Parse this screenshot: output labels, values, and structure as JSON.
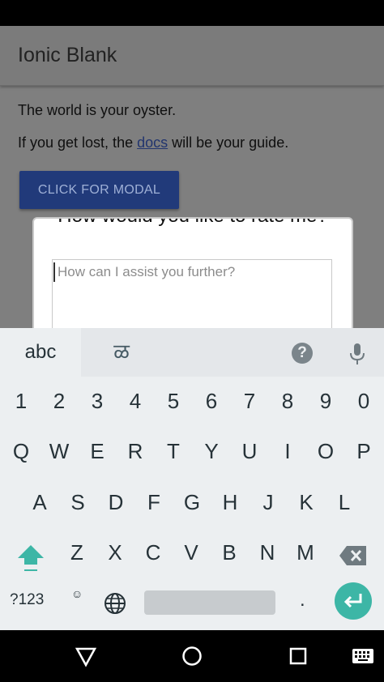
{
  "app": {
    "title": "Ionic Blank",
    "line1": "The world is your oyster.",
    "line2_before": "If you get lost, the ",
    "line2_link": "docs",
    "line2_after": " will be your guide.",
    "modal_button": "CLICK FOR MODAL"
  },
  "modal": {
    "question": "How would you like to rate me?",
    "placeholder": "How can I assist you further?"
  },
  "keyboard": {
    "tab_abc": "abc",
    "tab_kannada": "ळ",
    "help": "?",
    "row_numbers": [
      "1",
      "2",
      "3",
      "4",
      "5",
      "6",
      "7",
      "8",
      "9",
      "0"
    ],
    "row1": [
      "Q",
      "W",
      "E",
      "R",
      "T",
      "Y",
      "U",
      "I",
      "O",
      "P"
    ],
    "row2": [
      "A",
      "S",
      "D",
      "F",
      "G",
      "H",
      "J",
      "K",
      "L"
    ],
    "row3": [
      "Z",
      "X",
      "C",
      "V",
      "B",
      "N",
      "M"
    ],
    "symbols": "?123",
    "emoji": "☺",
    "period": "."
  },
  "colors": {
    "accent": "#3db6a6",
    "button": "#213a7a"
  },
  "icons": {
    "help": "help-icon",
    "mic": "mic-icon",
    "shift": "shift-icon",
    "backspace": "backspace-icon",
    "globe": "globe-icon",
    "enter": "enter-icon",
    "back": "nav-back-icon",
    "home": "nav-home-icon",
    "recents": "nav-recents-icon",
    "keyboard": "nav-keyboard-icon"
  }
}
